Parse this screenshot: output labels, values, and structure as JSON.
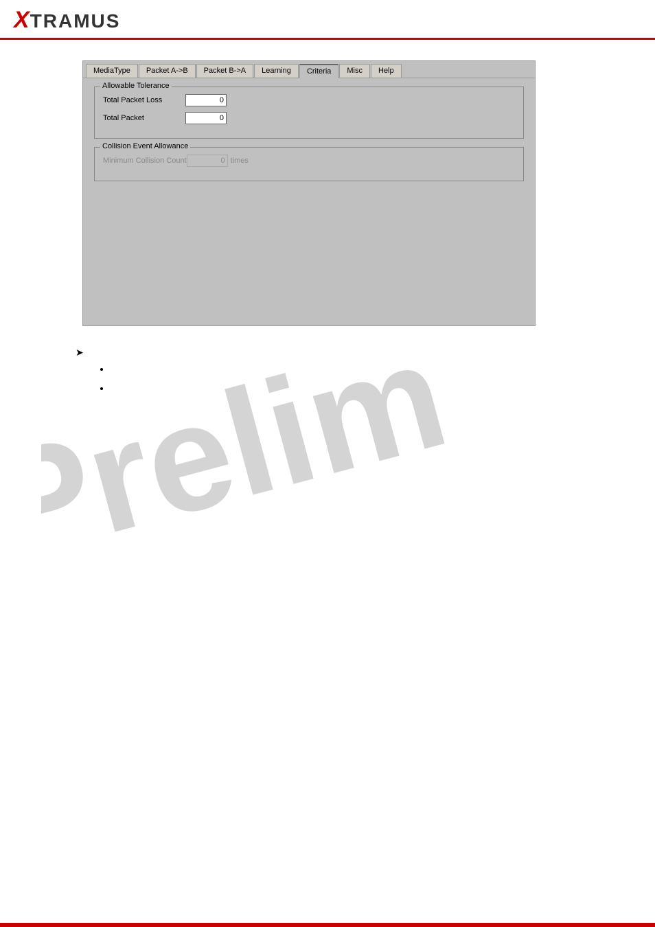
{
  "header": {
    "logo_x": "X",
    "logo_rest": "TRAMUS"
  },
  "tabs": {
    "items": [
      {
        "id": "mediatype",
        "label": "MediaType",
        "active": false
      },
      {
        "id": "packet-ab",
        "label": "Packet A->B",
        "active": false
      },
      {
        "id": "packet-ba",
        "label": "Packet B->A",
        "active": false
      },
      {
        "id": "learning",
        "label": "Learning",
        "active": false
      },
      {
        "id": "criteria",
        "label": "Criteria",
        "active": true
      },
      {
        "id": "misc",
        "label": "Misc",
        "active": false
      },
      {
        "id": "help",
        "label": "Help",
        "active": false
      }
    ]
  },
  "criteria_tab": {
    "allowable_tolerance_title": "Allowable Tolerance",
    "total_packet_loss_label": "Total Packet Loss",
    "total_packet_loss_value": "0",
    "total_packet_label": "Total Packet",
    "total_packet_value": "0",
    "collision_event_title": "Collision Event Allowance",
    "minimum_collision_label": "Minimum Collision Count",
    "minimum_collision_value": "0",
    "times_suffix": "times"
  },
  "watermark": {
    "text": "Prelim"
  },
  "bullets": {
    "arrow": "➤",
    "items": [
      "",
      ""
    ]
  }
}
